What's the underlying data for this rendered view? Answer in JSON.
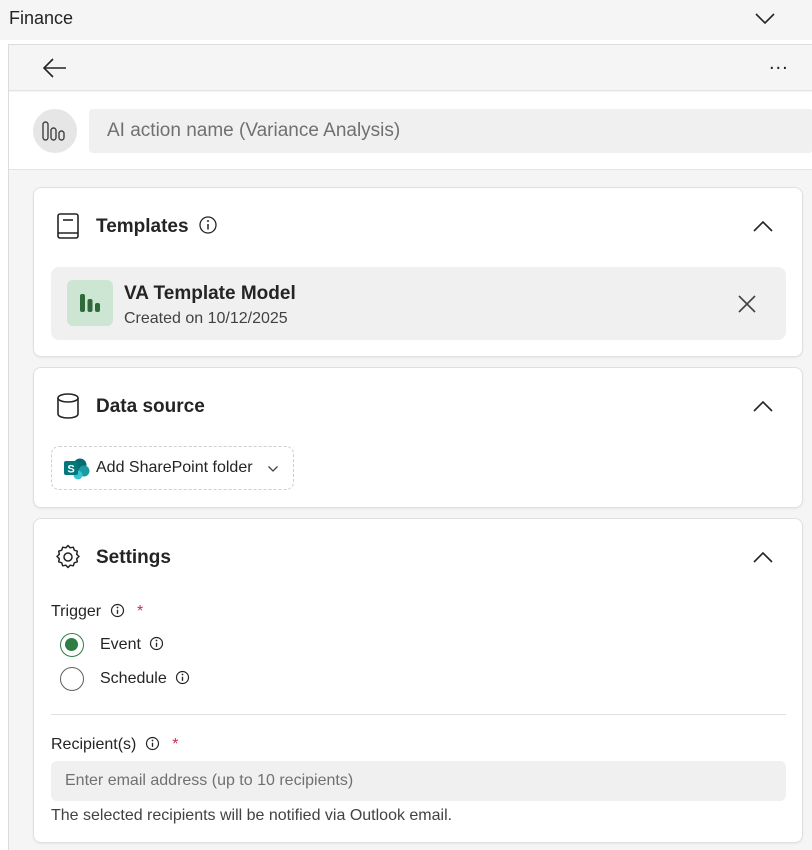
{
  "app": {
    "title": "Finance"
  },
  "nav": {
    "more_label": "..."
  },
  "action_name": {
    "placeholder": "AI action name (Variance Analysis)",
    "value": ""
  },
  "templates": {
    "title": "Templates",
    "selected": {
      "name": "VA Template Model",
      "created": "Created on 10/12/2025"
    }
  },
  "data_source": {
    "title": "Data source",
    "add_button_label": "Add SharePoint folder"
  },
  "settings": {
    "title": "Settings",
    "trigger_label": "Trigger",
    "required_mark": "*",
    "trigger_options": [
      {
        "label": "Event",
        "checked": true
      },
      {
        "label": "Schedule",
        "checked": false
      }
    ],
    "recipients_label": "Recipient(s)",
    "recipients_placeholder": "Enter email address (up to 10 recipients)",
    "recipients_helper": "The selected recipients will be notified via Outlook email."
  },
  "colors": {
    "accent": "#2f7d42",
    "required": "#c4314b",
    "template_logo_bg": "#cde6d3"
  },
  "icons": {
    "collapse": "chevron-down-icon",
    "back": "arrow-left-icon",
    "more": "more-horizontal-icon",
    "avatar": "bar-chart-icon",
    "templates": "book-icon",
    "info": "info-icon",
    "card_collapse": "chevron-up-icon",
    "template_logo": "bar-chart-icon",
    "remove": "close-icon",
    "data_source": "database-icon",
    "sharepoint": "sharepoint-icon",
    "dropdown": "chevron-down-icon",
    "settings": "gear-icon"
  }
}
